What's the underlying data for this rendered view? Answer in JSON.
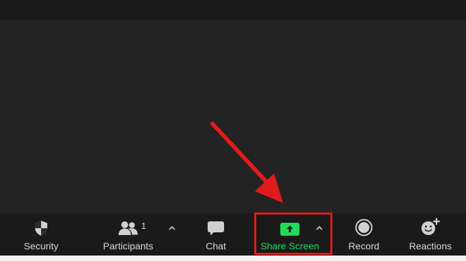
{
  "toolbar": {
    "security_label": "Security",
    "participants_label": "Participants",
    "participants_count": "1",
    "chat_label": "Chat",
    "share_screen_label": "Share Screen",
    "record_label": "Record",
    "reactions_label": "Reactions",
    "icons": {
      "security": "shield-icon",
      "participants": "people-icon",
      "chat": "chat-bubble-icon",
      "share_screen": "upload-arrow-icon",
      "record": "record-circle-icon",
      "reactions": "smiley-plus-icon",
      "caret": "caret-up-icon"
    }
  },
  "annotation": {
    "highlight_color": "#e01b1b",
    "arrow_color": "#e01b1b"
  },
  "colors": {
    "toolbar_bg": "#1a1a1a",
    "video_bg": "#232323",
    "label": "#d8d8d8",
    "share_green": "#23d959"
  }
}
